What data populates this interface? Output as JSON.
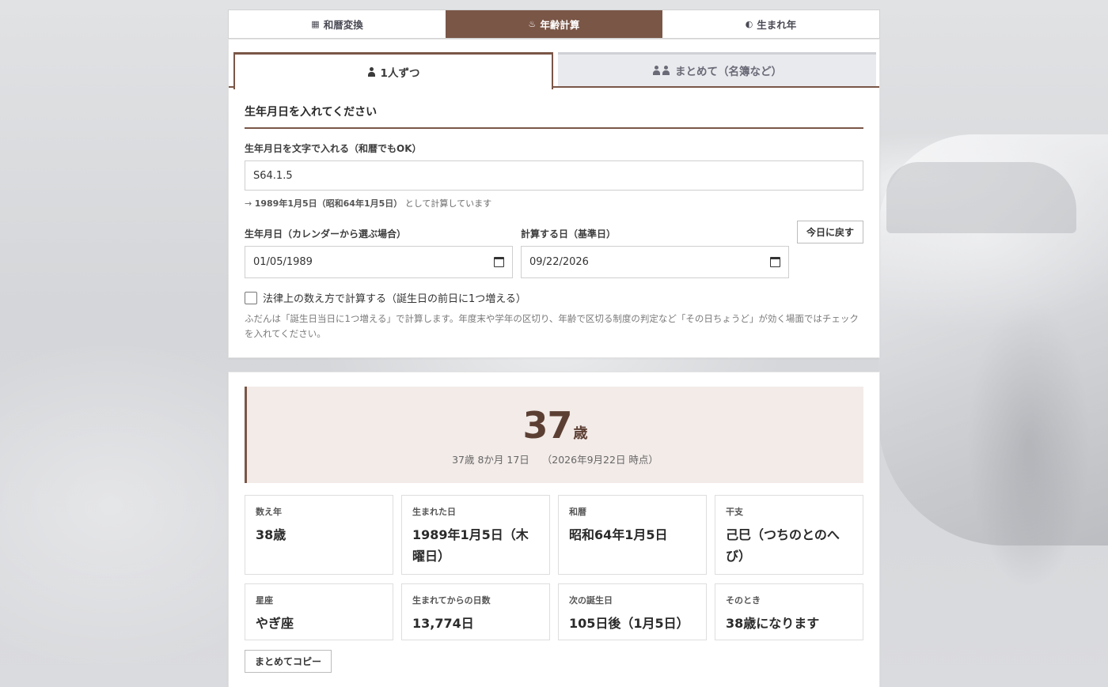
{
  "nav": {
    "items": [
      {
        "icon": "calendar-icon",
        "glyph": "▦",
        "label": "和暦変換",
        "active": false
      },
      {
        "icon": "birthday-cake-icon",
        "glyph": "♨",
        "label": "年齢計算",
        "active": true
      },
      {
        "icon": "history-icon",
        "glyph": "◐",
        "label": "生まれ年",
        "active": false
      }
    ]
  },
  "subtabs": {
    "single": "1人ずつ",
    "batch": "まとめて（名簿など）"
  },
  "form": {
    "section_title": "生年月日を入れてください",
    "text_label": "生年月日を文字で入れる（和暦でもOK）",
    "text_value": "S64.1.5",
    "hint_prefix": "→",
    "hint_date": "1989年1月5日（昭和64年1月5日）",
    "hint_suffix": "として計算しています",
    "birth_label": "生年月日（カレンダーから選ぶ場合）",
    "birth_value": "01/05/1989",
    "calc_label": "計算する日（基準日）",
    "calc_value": "09/22/2026",
    "today_button": "今日に戻す",
    "legal_check_label": "法律上の数え方で計算する（誕生日の前日に1つ増える）",
    "note": "ふだんは「誕生日当日に1つ増える」で計算します。年度末や学年の区切り、年齢で区切る制度の判定など「その日ちょうど」が効く場面ではチェックを入れてください。"
  },
  "result": {
    "age_number": "37",
    "age_unit": "歳",
    "age_detail": "37歳 8か月 17日",
    "as_of": "（2026年9月22日 時点）",
    "cells": [
      {
        "label": "数え年",
        "value": "38歳"
      },
      {
        "label": "生まれた日",
        "value": "1989年1月5日（木曜日）"
      },
      {
        "label": "和暦",
        "value": "昭和64年1月5日"
      },
      {
        "label": "干支",
        "value": "己巳（つちのとのへび）"
      },
      {
        "label": "星座",
        "value": "やぎ座"
      },
      {
        "label": "生まれてからの日数",
        "value": "13,774日"
      },
      {
        "label": "次の誕生日",
        "value": "105日後（1月5日）"
      },
      {
        "label": "そのとき",
        "value": "38歳になります"
      }
    ],
    "copy_button": "まとめてコピー"
  },
  "colors": {
    "accent": "#7a5647",
    "result_bg": "#f2ebe8"
  }
}
